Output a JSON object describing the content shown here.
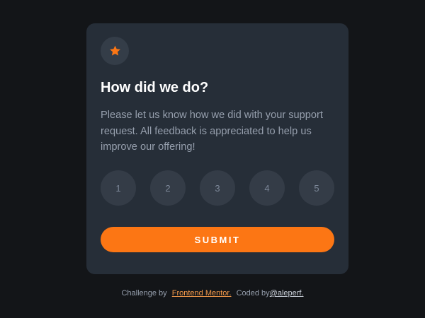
{
  "card": {
    "icon": "star-icon",
    "title": "How did we do?",
    "description": "Please let us know how we did with your support request. All feedback is appreciated to help us improve our offering!",
    "ratings": [
      "1",
      "2",
      "3",
      "4",
      "5"
    ],
    "submit_label": "SUBMIT"
  },
  "attribution": {
    "challenge_prefix": "Challenge by",
    "challenge_link": "Frontend Mentor.",
    "coded_prefix": "Coded by",
    "author_link": "@aleperf."
  },
  "colors": {
    "background": "#131518",
    "card": "#262e38",
    "accent": "#fc7614",
    "rating_bg": "#343c47"
  }
}
